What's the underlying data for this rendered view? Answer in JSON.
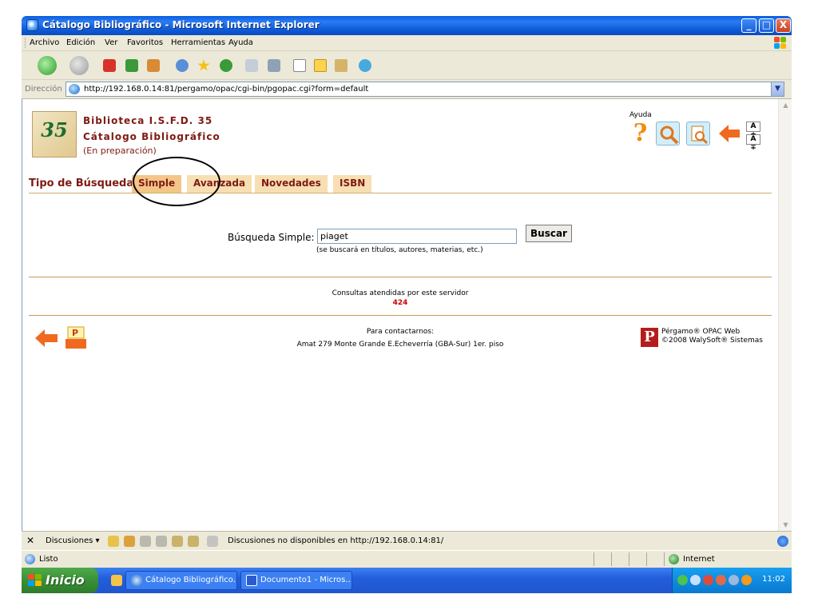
{
  "window": {
    "title": "Cátalogo Bibliográfico - Microsoft Internet Explorer",
    "buttons": {
      "minimize": "_",
      "maximize": "□",
      "close": "X"
    }
  },
  "menu": [
    "Archivo",
    "Edición",
    "Ver",
    "Favoritos",
    "Herramientas",
    "Ayuda"
  ],
  "address": {
    "label": "Dirección",
    "url": "http://192.168.0.14:81/pergamo/opac/cgi-bin/pgopac.cgi?form=default"
  },
  "page": {
    "logo_number": "35",
    "library_title": "Biblioteca I.S.F.D. 35",
    "catalog_title": "Cátalogo Bibliográfico",
    "status_note": "(En preparación)",
    "help_label": "Ayuda",
    "font_increase": "A ±",
    "font_decrease": "A ∓",
    "search_type_label": "Tipo de Búsqueda",
    "tabs": [
      "Simple",
      "Avanzada",
      "Novedades",
      "ISBN"
    ],
    "active_tab": "Simple",
    "search": {
      "label": "Búsqueda Simple:",
      "value": "piaget",
      "hint": "(se buscará en títulos, autores, materias, etc.)",
      "button": "Buscar"
    },
    "queries_label": "Consultas atendidas por este servidor",
    "queries_count": "424",
    "contact_label": "Para contactarnos:",
    "contact_address": "Amat 279 Monte Grande E.Echeverría (GBA-Sur) 1er. piso",
    "pergamo_line1": "Pérgamo® OPAC Web",
    "pergamo_line2": "©2008 WalySoft® Sistemas"
  },
  "discussions": {
    "label": "Discusiones ▾",
    "message": "Discusiones no disponibles en http://192.168.0.14:81/"
  },
  "status": {
    "text": "Listo",
    "zone": "Internet"
  },
  "taskbar": {
    "start": "Inicio",
    "tasks": [
      "Cátalogo Bibliográfico...",
      "Documento1 - Micros..."
    ],
    "clock": "11:02"
  },
  "colors": {
    "title_blue": "#0a5ee0",
    "library_red": "#7e1a13",
    "tab_bg": "#f7dfb3",
    "count_red": "#cc0000"
  }
}
